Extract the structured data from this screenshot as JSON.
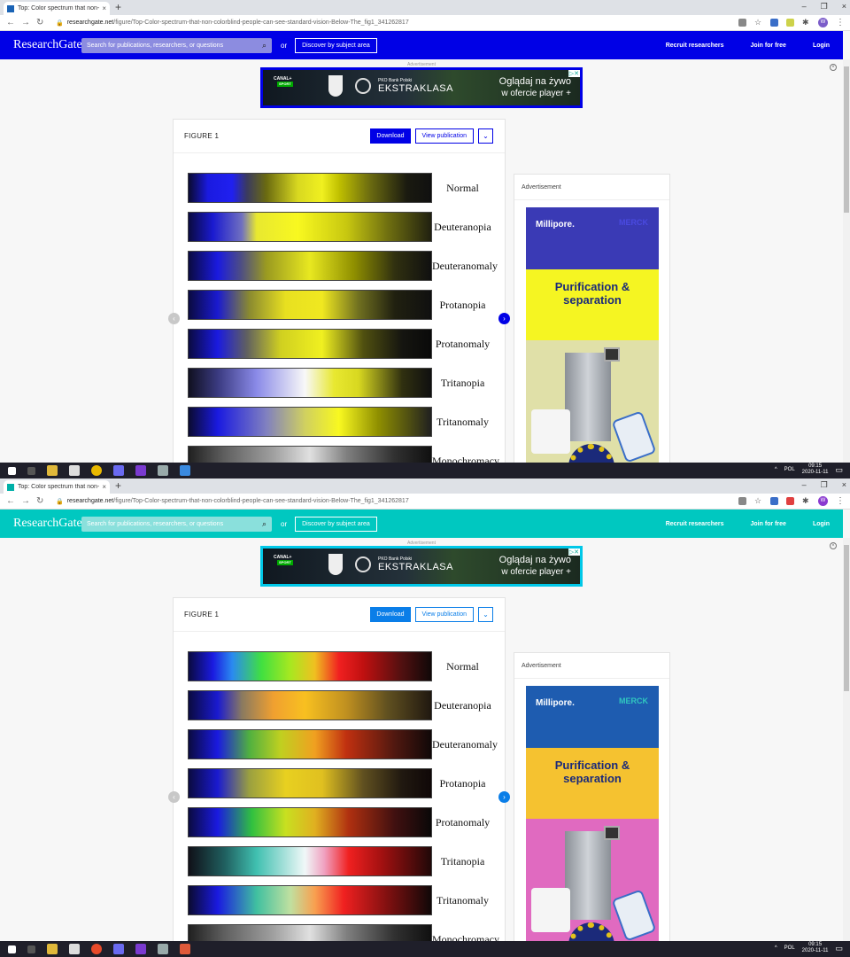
{
  "browser": {
    "tab_title": "Top: Color spectrum that non-co",
    "tab_close": "×",
    "new_tab": "+",
    "win_min": "–",
    "win_restore": "❐",
    "win_close": "×",
    "url_domain": "researchgate.net",
    "url_path": "/figure/Top-Color-spectrum-that-non-colorblind-people-can-see-standard-vision-Below-The_fig1_341262817",
    "profile_initial": "W"
  },
  "header": {
    "logo": "ResearchGate",
    "search_placeholder": "Search for publications, researchers, or questions",
    "or": "or",
    "discover": "Discover by subject area",
    "recruit": "Recruit researchers",
    "join": "Join for free",
    "login": "Login"
  },
  "ad_banner": {
    "label": "Advertisement",
    "canal": "CANAL+",
    "sport": "SPORT",
    "pko": "PKO Bank Polski",
    "ekstraklasa": "EKSTRAKLASA",
    "line1": "Oglądaj na żywo",
    "line2": "w ofercie player +"
  },
  "figure": {
    "label": "FIGURE 1",
    "download": "Download",
    "view_publication": "View publication",
    "more": "⌄",
    "prev": "‹",
    "next": "›",
    "rows": [
      "Normal",
      "Deuteranopia",
      "Deuteranomaly",
      "Protanopia",
      "Protanomaly",
      "Tritanopia",
      "Tritanomaly",
      "Monochromacy"
    ]
  },
  "side_ad": {
    "label": "Advertisement",
    "brand": "Millipore.",
    "merck": "MERCK",
    "headline": "Purification & separation"
  },
  "taskbar": {
    "lang": "POL",
    "time": "09:15",
    "date": "2020-11-11"
  },
  "themes": {
    "top": {
      "header": "#0000e6",
      "search_bg": "#8c8ce0",
      "accent": "#0000e6",
      "ad_border": "#0000e6",
      "sa_top": "#3a3ab5",
      "sa_mid": "#f5f522",
      "sa_bottom": "#e0e0a8",
      "merck": "#4a4ae0"
    },
    "bottom": {
      "header": "#00c8c0",
      "search_bg": "#8ae0dc",
      "accent": "#0a7ee8",
      "ad_border": "#00c8e8",
      "sa_top": "#1e5cb0",
      "sa_mid": "#f5c230",
      "sa_bottom": "#e06ac0",
      "merck": "#30c8c0"
    }
  }
}
